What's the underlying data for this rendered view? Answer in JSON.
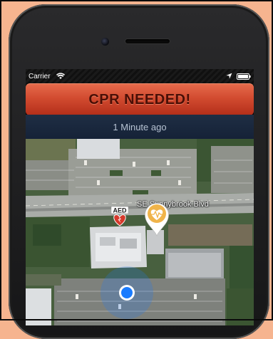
{
  "status_bar": {
    "carrier": "Carrier",
    "time": "",
    "wifi_icon": "wifi-icon",
    "location_icon": "location-arrow-icon",
    "battery_icon": "battery-icon"
  },
  "banner": {
    "title": "CPR NEEDED!",
    "color": "#d24b30",
    "text_color": "#4a0f06"
  },
  "alert": {
    "time_ago": "1 Minute ago"
  },
  "map": {
    "street_label": "SE Sunnybrook Blvd",
    "aed_marker": {
      "label": "AED",
      "icon": "heart-icon"
    },
    "emergency_marker": {
      "icon": "heart-pulse-icon",
      "color": "#f0b44a"
    },
    "user_location_color": "#1a7cff"
  },
  "colors": {
    "background": "#f6b48f",
    "phone_body": "#1f1f21",
    "time_bar": "#1a283d"
  }
}
